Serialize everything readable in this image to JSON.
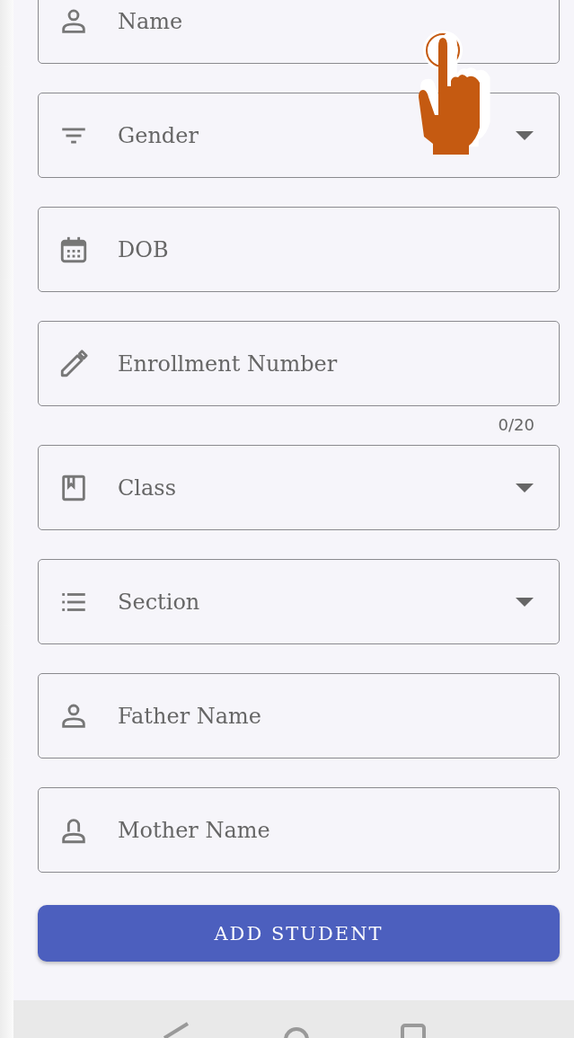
{
  "fields": [
    {
      "kind": "text",
      "placeholder": "Name"
    },
    {
      "kind": "select",
      "placeholder": "Gender"
    },
    {
      "kind": "text",
      "placeholder": "DOB"
    },
    {
      "kind": "text",
      "placeholder": "Enrollment Number",
      "counter": "0/20"
    },
    {
      "kind": "select",
      "placeholder": "Class"
    },
    {
      "kind": "select",
      "placeholder": "Section"
    },
    {
      "kind": "text",
      "placeholder": "Father Name"
    },
    {
      "kind": "text",
      "placeholder": "Mother Name"
    }
  ],
  "button": "ADD STUDENT"
}
